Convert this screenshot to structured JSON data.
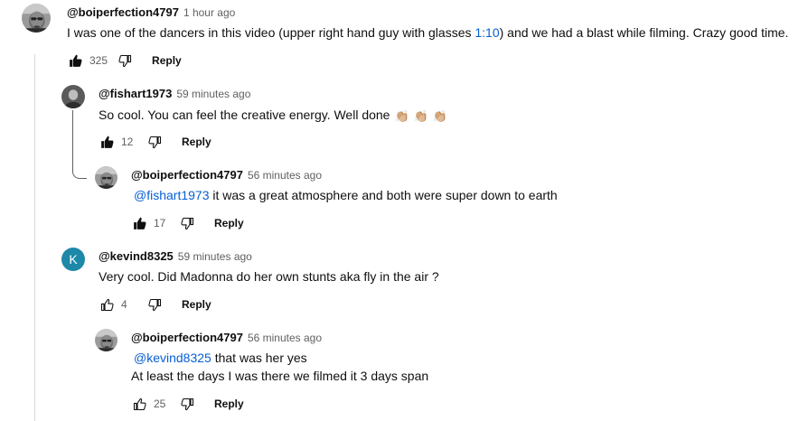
{
  "comments": [
    {
      "author": "@boiperfection4797",
      "time": "1 hour ago",
      "text_before": "I was one of the dancers in this video (upper right hand guy with glasses ",
      "timestamp_link": "1:10",
      "text_after": ") and we had a blast while filming. Crazy good time.",
      "likes": "325",
      "reply_label": "Reply"
    },
    {
      "author": "@fishart1973",
      "time": "59 minutes ago",
      "text": "So cool. You can feel the creative energy. Well done",
      "emoji": "👏🏼",
      "likes": "12",
      "reply_label": "Reply"
    },
    {
      "author": "@boiperfection4797",
      "time": "56 minutes ago",
      "mention": "@fishart1973",
      "text": " it was a great atmosphere and both were super down to earth",
      "likes": "17",
      "reply_label": "Reply"
    },
    {
      "author": "@kevind8325",
      "avatar_letter": "K",
      "time": "59 minutes ago",
      "text": "Very cool. Did Madonna do her own stunts aka fly in the air ?",
      "likes": "4",
      "reply_label": "Reply"
    },
    {
      "author": "@boiperfection4797",
      "time": "56 minutes ago",
      "mention": "@kevind8325",
      "text": " that was her yes",
      "text_line2": "At least the days I was there we filmed it 3 days span",
      "likes": "25",
      "reply_label": "Reply"
    }
  ],
  "colors": {
    "link": "#065fd4",
    "avatar_k": "#1e88a8",
    "secondary_text": "#606060"
  },
  "icons": {
    "like": "thumbs-up-icon",
    "dislike": "thumbs-down-icon"
  }
}
